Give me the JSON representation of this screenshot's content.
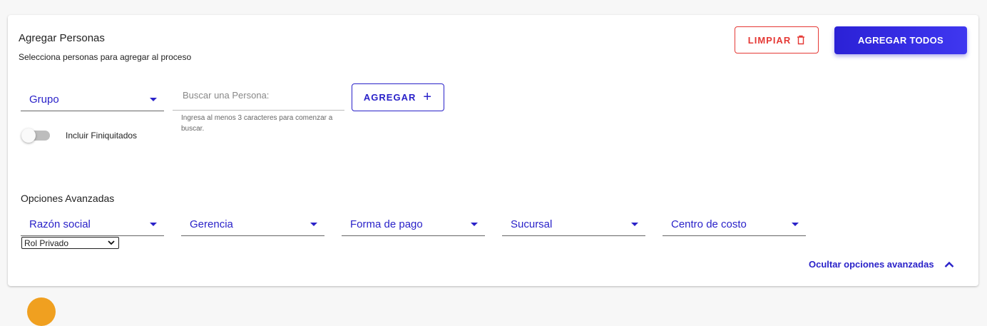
{
  "header": {
    "title": "Agregar Personas",
    "subtitle": "Selecciona personas para agregar al proceso"
  },
  "actions": {
    "clear_label": "LIMPIAR",
    "add_all_label": "AGREGAR TODOS"
  },
  "filters": {
    "group_label": "Grupo",
    "search_placeholder": "Buscar una Persona:",
    "search_value": "",
    "search_hint": "Ingresa al menos 3 caracteres para comenzar a buscar.",
    "add_label": "AGREGAR",
    "include_terminated_label": "Incluir Finiquitados",
    "include_terminated_on": false
  },
  "advanced": {
    "title": "Opciones Avanzadas",
    "selects": [
      {
        "label": "Razón social"
      },
      {
        "label": "Gerencia"
      },
      {
        "label": "Forma de pago"
      },
      {
        "label": "Sucursal"
      },
      {
        "label": "Centro de costo"
      }
    ],
    "rol_value": "Rol Privado",
    "hide_label": "Ocultar opciones avanzadas"
  },
  "icons": {
    "clear": "trash-icon",
    "add": "plus-icon",
    "dropdown": "caret-down-icon",
    "hide": "chevron-up-icon"
  },
  "colors": {
    "primary": "#2a22c9",
    "danger": "#e53935",
    "background": "#f7f7f7",
    "card": "#ffffff"
  }
}
